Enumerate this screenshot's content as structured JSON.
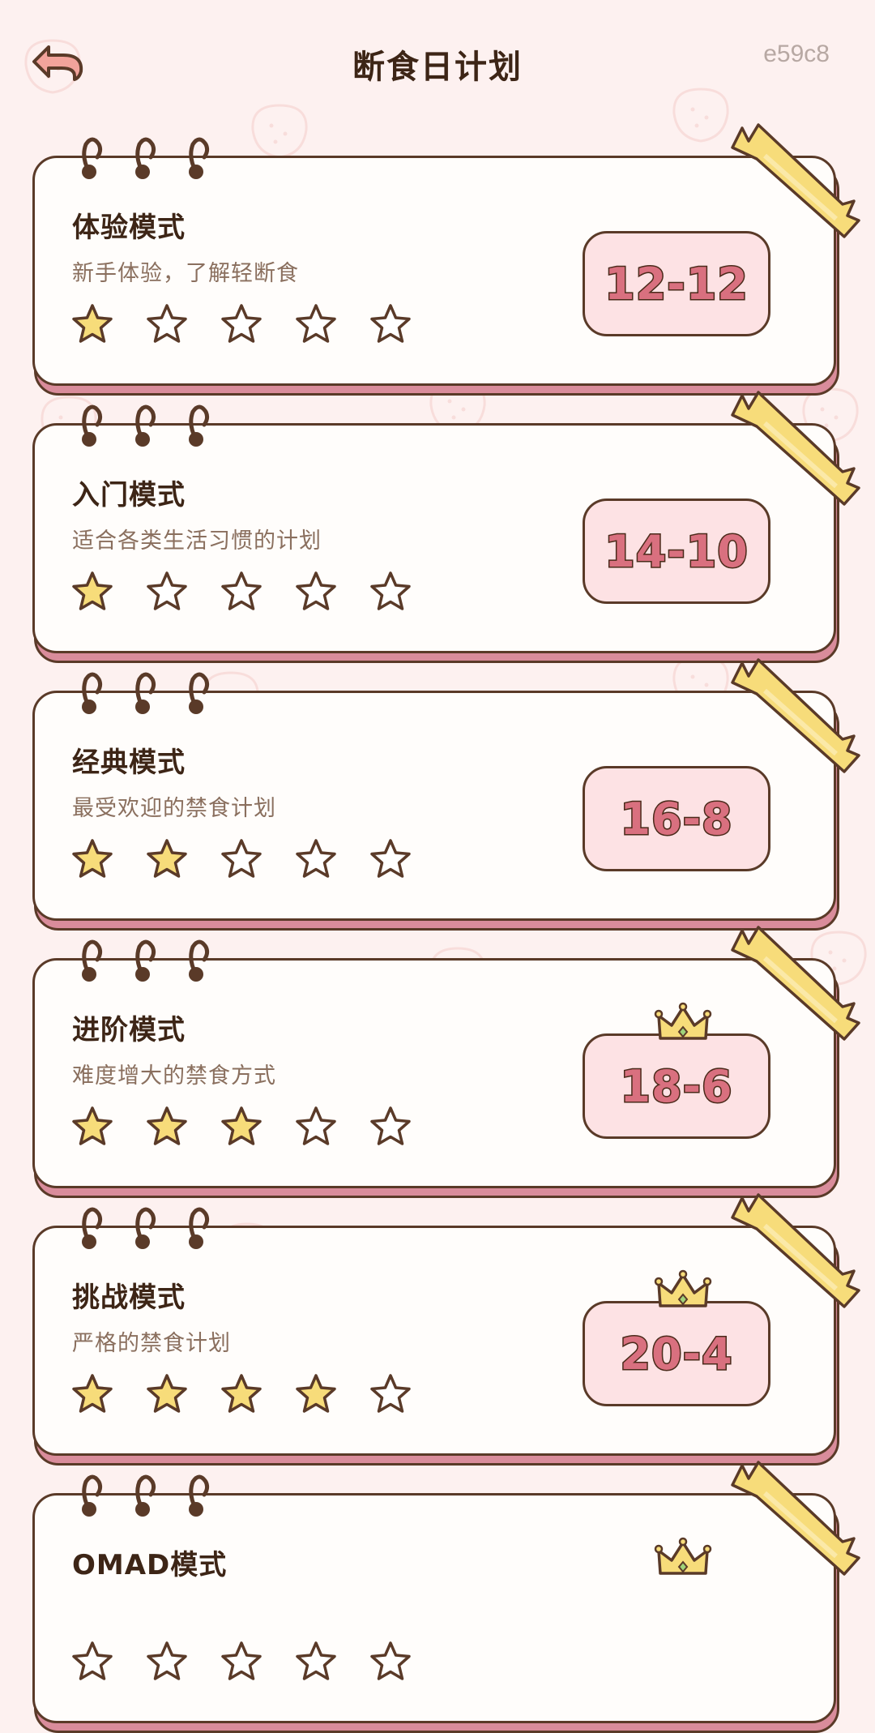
{
  "header": {
    "back_icon": "back-arrow-icon",
    "title": "断食日计划",
    "device_id": "e59c8"
  },
  "colors": {
    "background": "#fdf1f0",
    "card_shadow": "#d98c9b",
    "badge_fill": "#fde2e4",
    "badge_text": "#d9707f",
    "star_filled": "#f7dc7a",
    "tape": "#f7dc7a",
    "outline": "#5a3a28"
  },
  "plans": [
    {
      "title": "体验模式",
      "description": "新手体验，了解轻断食",
      "ratio": "12-12",
      "stars": 1,
      "crown": false
    },
    {
      "title": "入门模式",
      "description": "适合各类生活习惯的计划",
      "ratio": "14-10",
      "stars": 1,
      "crown": false
    },
    {
      "title": "经典模式",
      "description": "最受欢迎的禁食计划",
      "ratio": "16-8",
      "stars": 2,
      "crown": false
    },
    {
      "title": "进阶模式",
      "description": "难度增大的禁食方式",
      "ratio": "18-6",
      "stars": 3,
      "crown": true
    },
    {
      "title": "挑战模式",
      "description": "严格的禁食计划",
      "ratio": "20-4",
      "stars": 4,
      "crown": true
    },
    {
      "title": "OMAD模式",
      "description": "",
      "ratio": "",
      "stars": 0,
      "crown": true
    }
  ],
  "max_stars": 5
}
